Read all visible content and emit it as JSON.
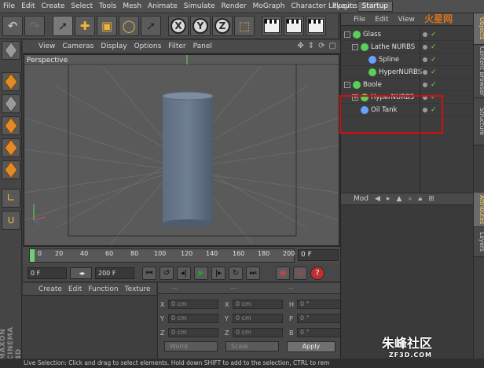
{
  "menubar": {
    "items": [
      "File",
      "Edit",
      "Create",
      "Select",
      "Tools",
      "Mesh",
      "Animate",
      "Simulate",
      "Render",
      "MoGraph",
      "Character",
      "Plugins"
    ],
    "layout_label": "Layout:",
    "layout_value": "Startup"
  },
  "toolbar": {
    "axis_x": "X",
    "axis_y": "Y",
    "axis_z": "Z"
  },
  "viewport": {
    "menu": [
      "View",
      "Cameras",
      "Display",
      "Options",
      "Filter",
      "Panel"
    ],
    "title": "Perspective"
  },
  "timeline": {
    "ticks": [
      "0",
      "20",
      "40",
      "60",
      "80",
      "100",
      "120",
      "140",
      "160",
      "180",
      "200"
    ],
    "frame_value": "0 F"
  },
  "transport": {
    "start_frame": "0 F",
    "end_frame": "200 F"
  },
  "material_manager": {
    "menu": [
      "Create",
      "Edit",
      "Function",
      "Texture"
    ]
  },
  "coordinates": {
    "headers": [
      "--",
      "--",
      "--"
    ],
    "rows": [
      {
        "a": "X",
        "av": "0 cm",
        "b": "X",
        "bv": "0 cm",
        "c": "H",
        "cv": "0 °"
      },
      {
        "a": "Y",
        "av": "0 cm",
        "b": "Y",
        "bv": "0 cm",
        "c": "P",
        "cv": "0 °"
      },
      {
        "a": "Z",
        "av": "0 cm",
        "b": "Z",
        "bv": "0 cm",
        "c": "B",
        "cv": "0 °"
      }
    ],
    "mode_dropdown": "World",
    "scale_dropdown": "Scale",
    "apply_label": "Apply"
  },
  "object_manager": {
    "menu": [
      "File",
      "Edit",
      "View"
    ],
    "objects": [
      {
        "name": "Glass",
        "indent": 0,
        "fold": "-",
        "icon_color": "#5ad05a"
      },
      {
        "name": "Lathe NURBS",
        "indent": 1,
        "fold": "-",
        "icon_color": "#5ad05a"
      },
      {
        "name": "Spline",
        "indent": 2,
        "fold": "",
        "icon_color": "#6aa0ff"
      },
      {
        "name": "HyperNURBS",
        "indent": 2,
        "fold": "",
        "icon_color": "#5ad05a"
      },
      {
        "name": "Boole",
        "indent": 0,
        "fold": "-",
        "icon_color": "#5ad05a"
      },
      {
        "name": "HyperNURBS",
        "indent": 1,
        "fold": "+",
        "icon_color": "#5ad05a"
      },
      {
        "name": "Oil Tank",
        "indent": 1,
        "fold": "",
        "icon_color": "#6aa0ff"
      }
    ]
  },
  "attribute_manager": {
    "mode_label": "Mod"
  },
  "side_tabs": [
    "Objects",
    "Content Browser",
    "Structure",
    "Attributes",
    "Layers"
  ],
  "statusbar": {
    "text": "Live Selection: Click and drag to select elements. Hold down SHIFT to add to the selection, CTRL to rem"
  },
  "branding": {
    "logo": "MAXON CINEMA 4D",
    "watermark_top": "火星网",
    "watermark_bottom": "朱峰社区",
    "watermark_bottom_sub": "ZF3D.COM"
  }
}
